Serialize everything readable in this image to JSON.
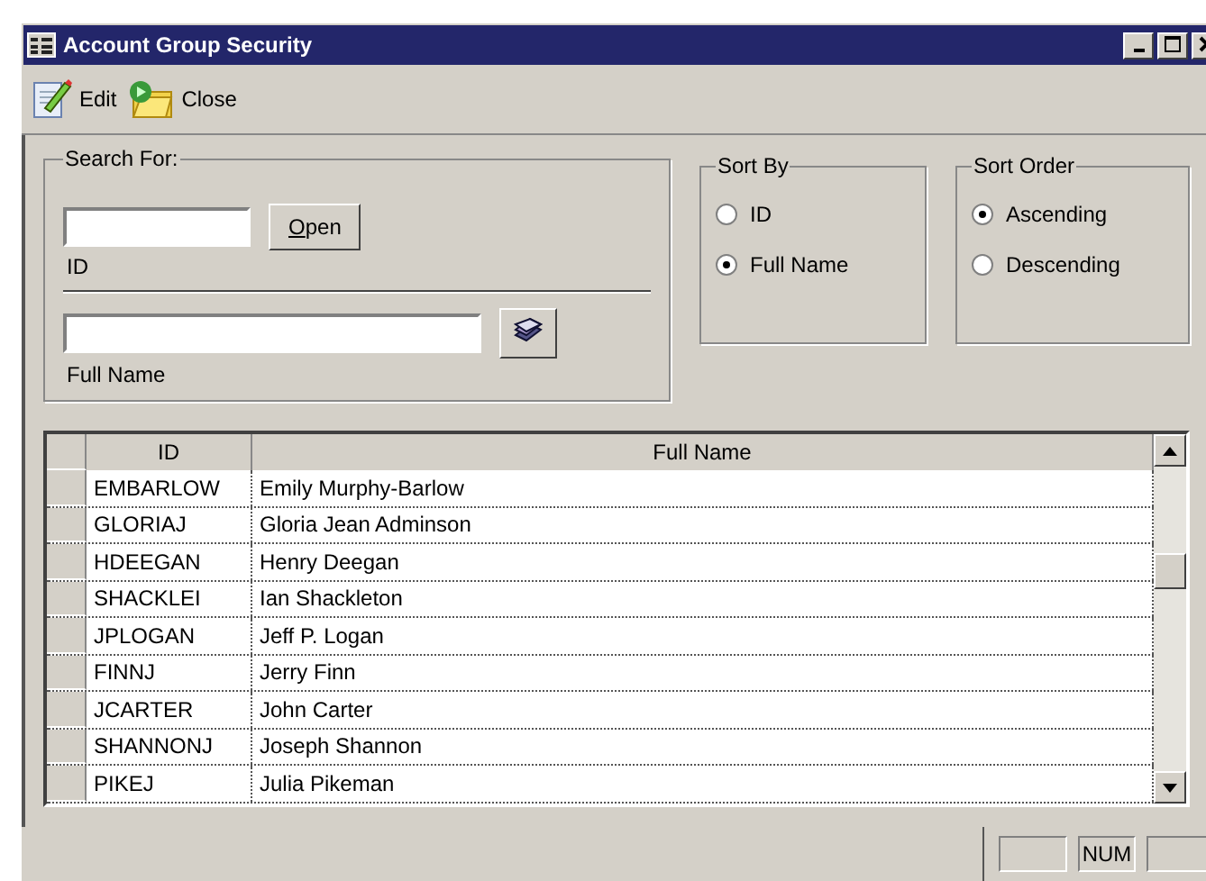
{
  "window": {
    "title": "Account Group Security"
  },
  "toolbar": [
    {
      "label": "Edit",
      "kind": "edit"
    },
    {
      "label": "Close",
      "kind": "close"
    }
  ],
  "search": {
    "title": "Search For:",
    "id_label": "ID",
    "open_button": "Open",
    "name_label": "Full Name"
  },
  "sort_by": {
    "title": "Sort By",
    "options": [
      {
        "label": "ID",
        "selected": false
      },
      {
        "label": "Full Name",
        "selected": true
      }
    ]
  },
  "sort_order": {
    "title": "Sort Order",
    "options": [
      {
        "label": "Ascending",
        "selected": true
      },
      {
        "label": "Descending",
        "selected": false
      }
    ]
  },
  "table": {
    "columns": [
      "ID",
      "Full Name"
    ],
    "rows": [
      {
        "id": "EMBARLOW",
        "name": "Emily Murphy-Barlow"
      },
      {
        "id": "GLORIAJ",
        "name": "Gloria Jean Adminson"
      },
      {
        "id": "HDEEGAN",
        "name": "Henry Deegan"
      },
      {
        "id": "SHACKLEI",
        "name": "Ian Shackleton"
      },
      {
        "id": "JPLOGAN",
        "name": "Jeff P. Logan"
      },
      {
        "id": "FINNJ",
        "name": "Jerry Finn"
      },
      {
        "id": "JCARTER",
        "name": "John Carter"
      },
      {
        "id": "SHANNONJ",
        "name": "Joseph Shannon"
      },
      {
        "id": "PIKEJ",
        "name": "Julia Pikeman"
      }
    ]
  },
  "status_bar": {
    "num": "NUM"
  }
}
